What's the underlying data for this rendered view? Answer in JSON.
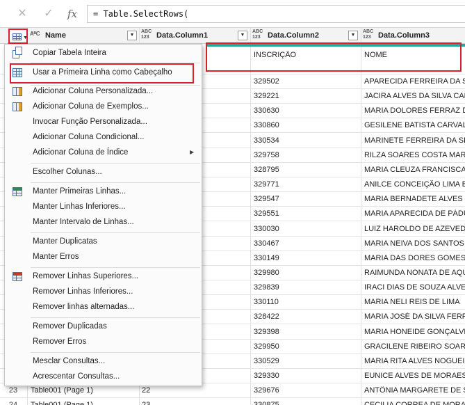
{
  "formula_bar": {
    "cancel_icon": "✕",
    "accept_icon": "✓",
    "fx_label": "fx",
    "formula": "= Table.SelectRows("
  },
  "columns": [
    {
      "type_icon": "AᴮC",
      "label": "Name"
    },
    {
      "type_icon": "ABC 123",
      "label": "Data.Column1"
    },
    {
      "type_icon": "ABC 123",
      "label": "Data.Column2"
    },
    {
      "type_icon": "ABC 123",
      "label": "Data.Column3"
    }
  ],
  "header_row": {
    "col2": "INSCRIÇÃO",
    "col3": "NOME"
  },
  "rows": [
    {
      "col2": "329502",
      "col3": "APARECIDA FERREIRA DA SILVA"
    },
    {
      "col2": "329221",
      "col3": "JACIRA ALVES DA SILVA CARLOS"
    },
    {
      "col2": "330630",
      "col3": "MARIA DOLORES FERRAZ DE A"
    },
    {
      "col2": "330860",
      "col3": "GESILENE BATISTA CARVALHO"
    },
    {
      "col2": "330534",
      "col3": "MARINETE FERREIRA DA SILVA"
    },
    {
      "col2": "329758",
      "col3": "RILZA SOARES COSTA MARINHO"
    },
    {
      "col2": "328795",
      "col3": "MARIA CLEUZA FRANCISCA DA"
    },
    {
      "col2": "329771",
      "col3": "ANILCE CONCEIÇÃO LIMA BAE"
    },
    {
      "col2": "329547",
      "col3": "MARIA BERNADETE ALVES RO"
    },
    {
      "col2": "329551",
      "col3": "MARIA APARECIDA DE PÁDUA"
    },
    {
      "col2": "330030",
      "col3": "LUIZ HAROLDO DE AZEVEDO"
    },
    {
      "col2": "330467",
      "col3": "MARIA NEIVA DOS SANTOS"
    },
    {
      "col2": "330149",
      "col3": "MARIA DAS DORES GOMES AC"
    },
    {
      "col2": "329980",
      "col3": "RAIMUNDA NONATA DE AQUI"
    },
    {
      "col2": "329839",
      "col3": "IRACI DIAS DE SOUZA ALVES"
    },
    {
      "col2": "330110",
      "col3": "MARIA NELI REIS DE LIMA"
    },
    {
      "col2": "328422",
      "col3": "MARIA JOSÉ DA SILVA FERREI"
    },
    {
      "col2": "329398",
      "col3": "MARIA HONEIDE GONÇALVES"
    },
    {
      "col2": "329950",
      "col3": "GRACILENE RIBEIRO SOARES D"
    },
    {
      "col2": "330529",
      "col3": "MARIA RITA ALVES NOGUEIRA"
    },
    {
      "col2": "329330",
      "col3": "EUNICE ALVES DE MORAES V"
    },
    {
      "rownum": "23",
      "name": "Table001 (Page 1)",
      "col1": "22",
      "col2": "329676",
      "col3": "ANTÔNIA MARGARETE DE SOU"
    },
    {
      "rownum": "24",
      "name": "Table001 (Page 1)",
      "col1": "23",
      "col2": "330875",
      "col3": "CECILIA CORREA DE MORAES"
    }
  ],
  "menu": {
    "items": [
      {
        "label": "Copiar Tabela Inteira",
        "icon": "copy-icon"
      },
      {
        "label": "Usar a Primeira Linha como Cabeçalho",
        "icon": "table-icon"
      },
      {
        "label": "Adicionar Coluna Personalizada...",
        "icon": "add-column-icon"
      },
      {
        "label": "Adicionar Coluna de Exemplos...",
        "icon": "add-column-examples-icon"
      },
      {
        "label": "Invocar Função Personalizada...",
        "icon": ""
      },
      {
        "label": "Adicionar Coluna Condicional...",
        "icon": ""
      },
      {
        "label": "Adicionar Coluna de Índice",
        "icon": "",
        "submenu": "▶"
      },
      {
        "label": "Escolher Colunas...",
        "icon": ""
      },
      {
        "label": "Manter Primeiras Linhas...",
        "icon": "keep-rows-icon"
      },
      {
        "label": "Manter Linhas Inferiores...",
        "icon": ""
      },
      {
        "label": "Manter Intervalo de Linhas...",
        "icon": ""
      },
      {
        "label": "Manter Duplicatas",
        "icon": ""
      },
      {
        "label": "Manter Erros",
        "icon": ""
      },
      {
        "label": "Remover Linhas Superiores...",
        "icon": "remove-rows-icon"
      },
      {
        "label": "Remover Linhas Inferiores...",
        "icon": ""
      },
      {
        "label": "Remover linhas alternadas...",
        "icon": ""
      },
      {
        "label": "Remover Duplicadas",
        "icon": ""
      },
      {
        "label": "Remover Erros",
        "icon": ""
      },
      {
        "label": "Mesclar Consultas...",
        "icon": ""
      },
      {
        "label": "Acrescentar Consultas...",
        "icon": ""
      }
    ]
  },
  "colors": {
    "highlight": "#d9202b",
    "teal_bar": "#21a89a",
    "icon_blue": "#4a6ea8"
  }
}
